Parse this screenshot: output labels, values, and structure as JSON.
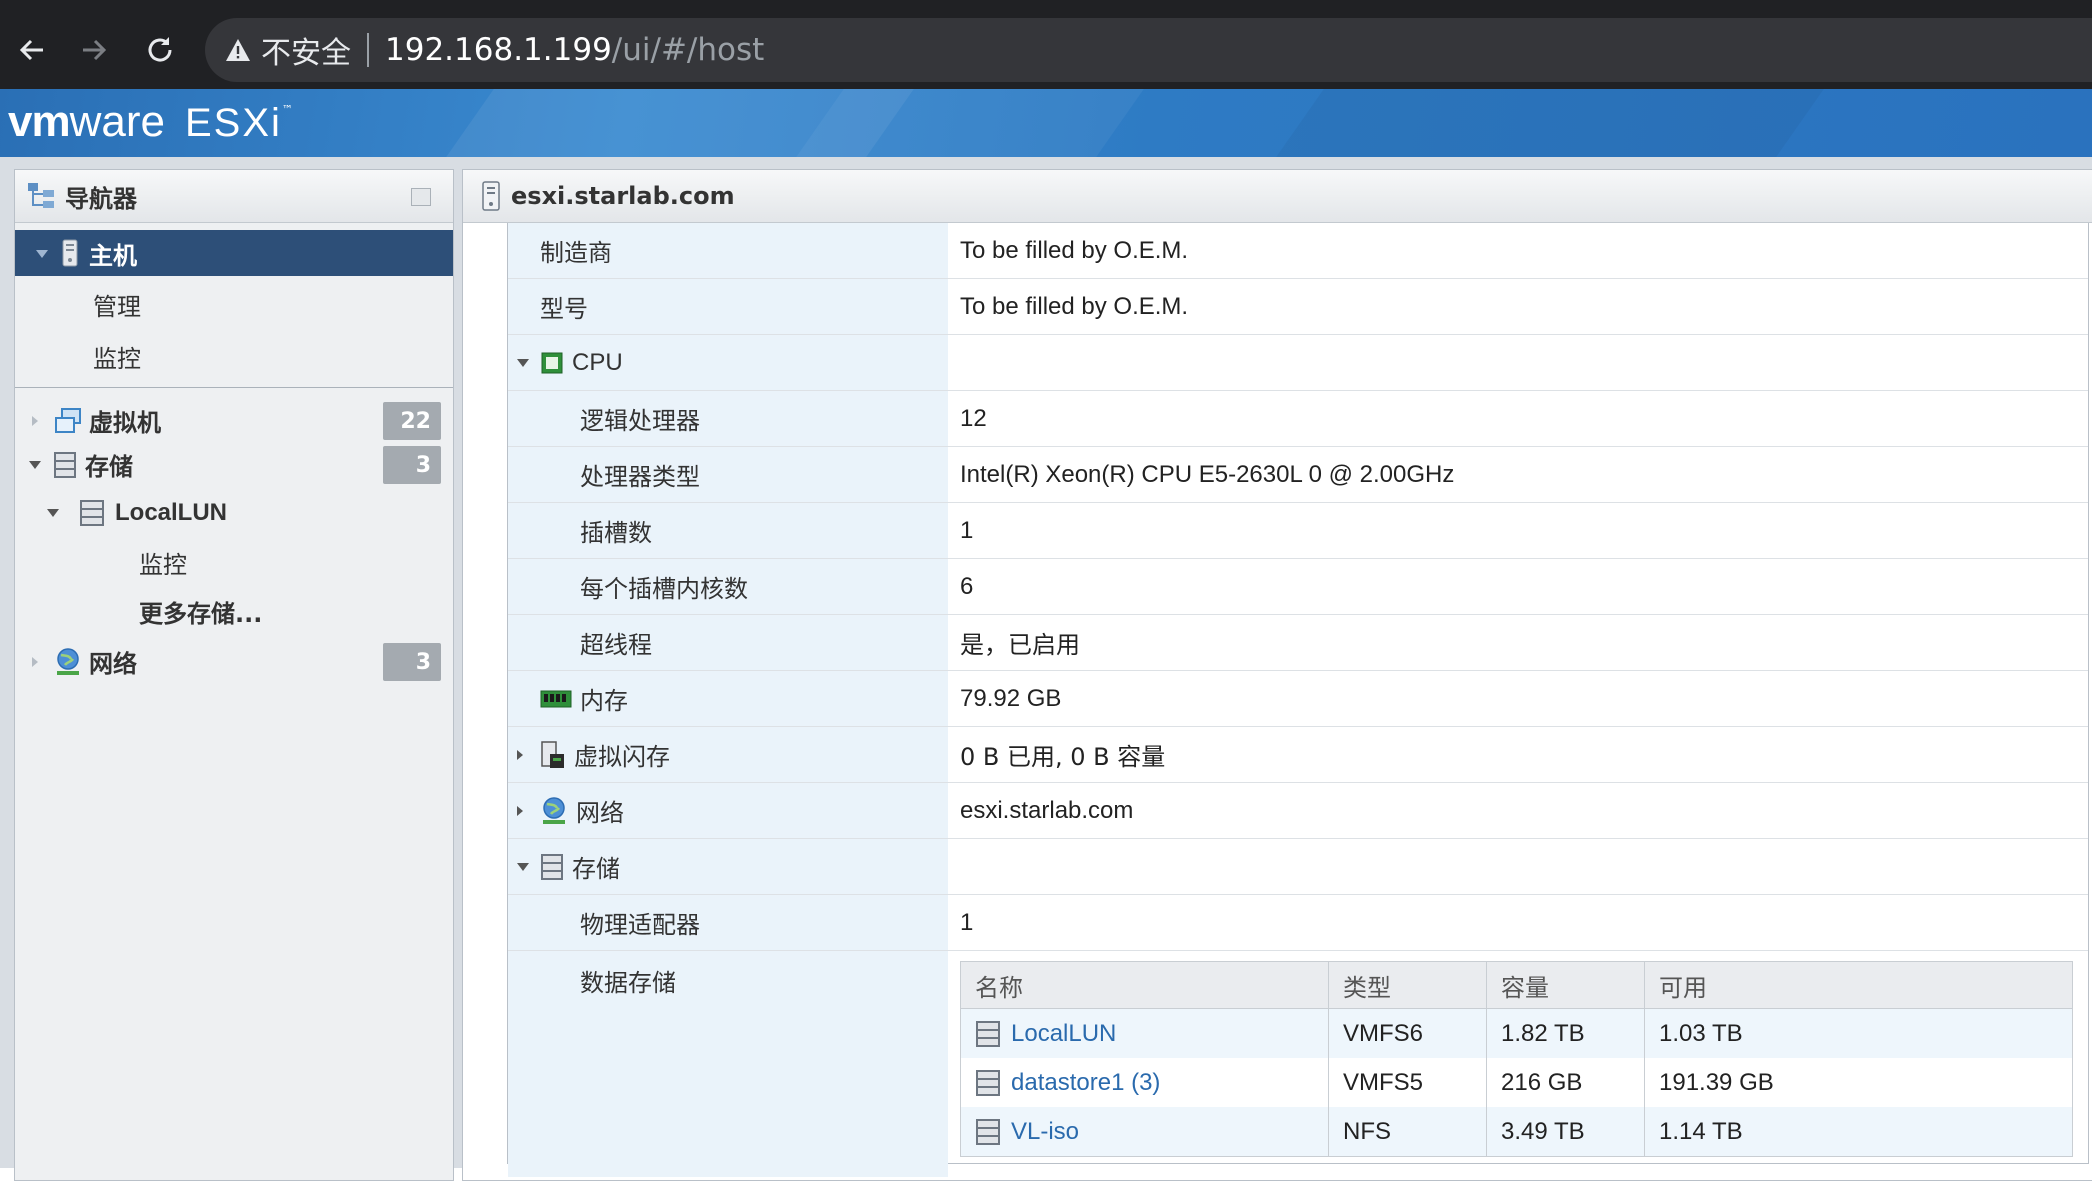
{
  "browser": {
    "insecure_label": "不安全",
    "url_host": "192.168.1.199",
    "url_path": "/ui/#/host"
  },
  "header": {
    "logo_vm": "vm",
    "logo_ware": "ware",
    "logo_product": "ESXi",
    "logo_tm": "™"
  },
  "navigator": {
    "title": "导航器",
    "host": {
      "label": "主机",
      "children": [
        "管理",
        "监控"
      ]
    },
    "items": [
      {
        "label": "虚拟机",
        "badge": "22"
      },
      {
        "label": "存储",
        "badge": "3"
      },
      {
        "label": "网络",
        "badge": "3"
      }
    ],
    "storage_children": {
      "localLUN": "LocalLUN",
      "monitor": "监控",
      "more": "更多存储..."
    }
  },
  "main": {
    "title": "esxi.starlab.com",
    "rows": {
      "manufacturer": {
        "key": "制造商",
        "value": "To be filled by O.E.M."
      },
      "model": {
        "key": "型号",
        "value": "To be filled by O.E.M."
      },
      "cpu": {
        "key": "CPU",
        "value": ""
      },
      "logical_processors": {
        "key": "逻辑处理器",
        "value": "12"
      },
      "processor_type": {
        "key": "处理器类型",
        "value": "Intel(R) Xeon(R) CPU E5-2630L 0 @ 2.00GHz"
      },
      "sockets": {
        "key": "插槽数",
        "value": "1"
      },
      "cores_per_socket": {
        "key": "每个插槽内核数",
        "value": "6"
      },
      "hyperthreading": {
        "key": "超线程",
        "value": "是，已启用"
      },
      "memory": {
        "key": "内存",
        "value": "79.92 GB"
      },
      "virtual_flash": {
        "key": "虚拟闪存",
        "value": "0 B 已用, 0 B 容量"
      },
      "network": {
        "key": "网络",
        "value": "esxi.starlab.com"
      },
      "storage": {
        "key": "存储",
        "value": ""
      },
      "physical_adapters": {
        "key": "物理适配器",
        "value": "1"
      },
      "datastores": {
        "key": "数据存储"
      }
    },
    "datastore_table": {
      "columns": [
        "名称",
        "类型",
        "容量",
        "可用"
      ],
      "rows": [
        {
          "name": "LocalLUN",
          "type": "VMFS6",
          "capacity": "1.82 TB",
          "free": "1.03 TB"
        },
        {
          "name": "datastore1 (3)",
          "type": "VMFS5",
          "capacity": "216 GB",
          "free": "191.39 GB"
        },
        {
          "name": "VL-iso",
          "type": "NFS",
          "capacity": "3.49 TB",
          "free": "1.14 TB"
        }
      ]
    }
  },
  "colors": {
    "nav_selected": "#2d4f78",
    "header_blue": "#2e7bc4",
    "row_key_bg": "#eaf3fa",
    "link": "#2a6aad"
  }
}
